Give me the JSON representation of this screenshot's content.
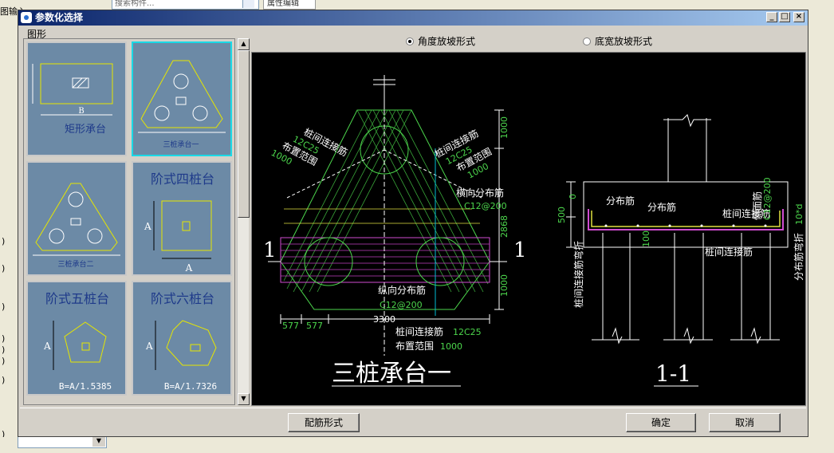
{
  "background": {
    "search_placeholder": "搜索构件...",
    "tab_label": "属性编辑",
    "left_label": "图输入"
  },
  "dialog": {
    "title": "参数化选择",
    "group_label": "图形",
    "radio_angle": "角度放坡形式",
    "radio_width": "底宽放坡形式",
    "rebar_button": "配筋形式",
    "ok_button": "确定",
    "cancel_button": "取消"
  },
  "thumbnails": [
    {
      "label": "矩形承台",
      "dim_b": "B",
      "selected": false
    },
    {
      "label": "三桩承台一",
      "selected": true
    },
    {
      "label": "三桩承台二",
      "selected": false
    },
    {
      "label": "阶式四桩台",
      "dim": "A",
      "selected": false
    },
    {
      "label": "阶式五桩台",
      "dim": "A",
      "formula": "B=A/1.5385",
      "selected": false
    },
    {
      "label": "阶式六桩台",
      "dim": "A",
      "formula": "B=A/1.7326",
      "selected": false
    }
  ],
  "drawing": {
    "plan_title": "三桩承台一",
    "section_title": "1-1",
    "section_mark": "1",
    "dim_1000_top": "1000",
    "dim_2868": "2868",
    "dim_1000_bottom": "1000",
    "dim_577_left": "577",
    "dim_577_right": "577",
    "dim_3300": "3300",
    "lbl_tie_left_1": "桩间连接筋",
    "lbl_tie_left_2": "12C25",
    "lbl_tie_left_3": "布置范围",
    "lbl_tie_left_4": "1000",
    "lbl_tie_right_1": "桩间连接筋",
    "lbl_tie_right_2": "12C25",
    "lbl_tie_right_3": "布置范围",
    "lbl_tie_right_4": "1000",
    "lbl_horiz_1": "横向分布筋",
    "lbl_horiz_2": "C12@200",
    "lbl_long_1": "纵向分布筋",
    "lbl_long_2": "C12@200",
    "lbl_bottom_1": "桩间连接筋",
    "lbl_bottom_2": "12C25",
    "lbl_bottom_3": "布置范围",
    "lbl_bottom_4": "1000",
    "sec_dist_1": "分布筋",
    "sec_dist_2": "分布筋",
    "sec_tie": "桩间连接筋",
    "sec_tie_bottom": "桩间连接筋",
    "sec_side_1": "侧面筋",
    "sec_side_2": "C12@200",
    "sec_hook_left": "桩间连接筋弯折",
    "sec_hook_right": "分布筋弯折",
    "sec_10d": "10*d",
    "sec_500": "500",
    "sec_0": "0",
    "sec_100": "100"
  }
}
